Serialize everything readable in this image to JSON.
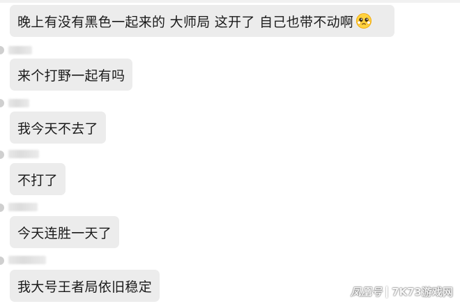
{
  "messages": [
    {
      "text": "晚上有没有黑色一起来的 大师局  这开了 自己也带不动啊",
      "emoji": "pleading-face-icon"
    },
    {
      "text": "来个打野一起有吗"
    },
    {
      "text": "我今天不去了"
    },
    {
      "text": "不打了"
    },
    {
      "text": "今天连胜一天了"
    },
    {
      "text": "我大号王者局依旧稳定"
    }
  ],
  "watermark": {
    "left": "凤凰号",
    "right": "7K73游戏网"
  }
}
